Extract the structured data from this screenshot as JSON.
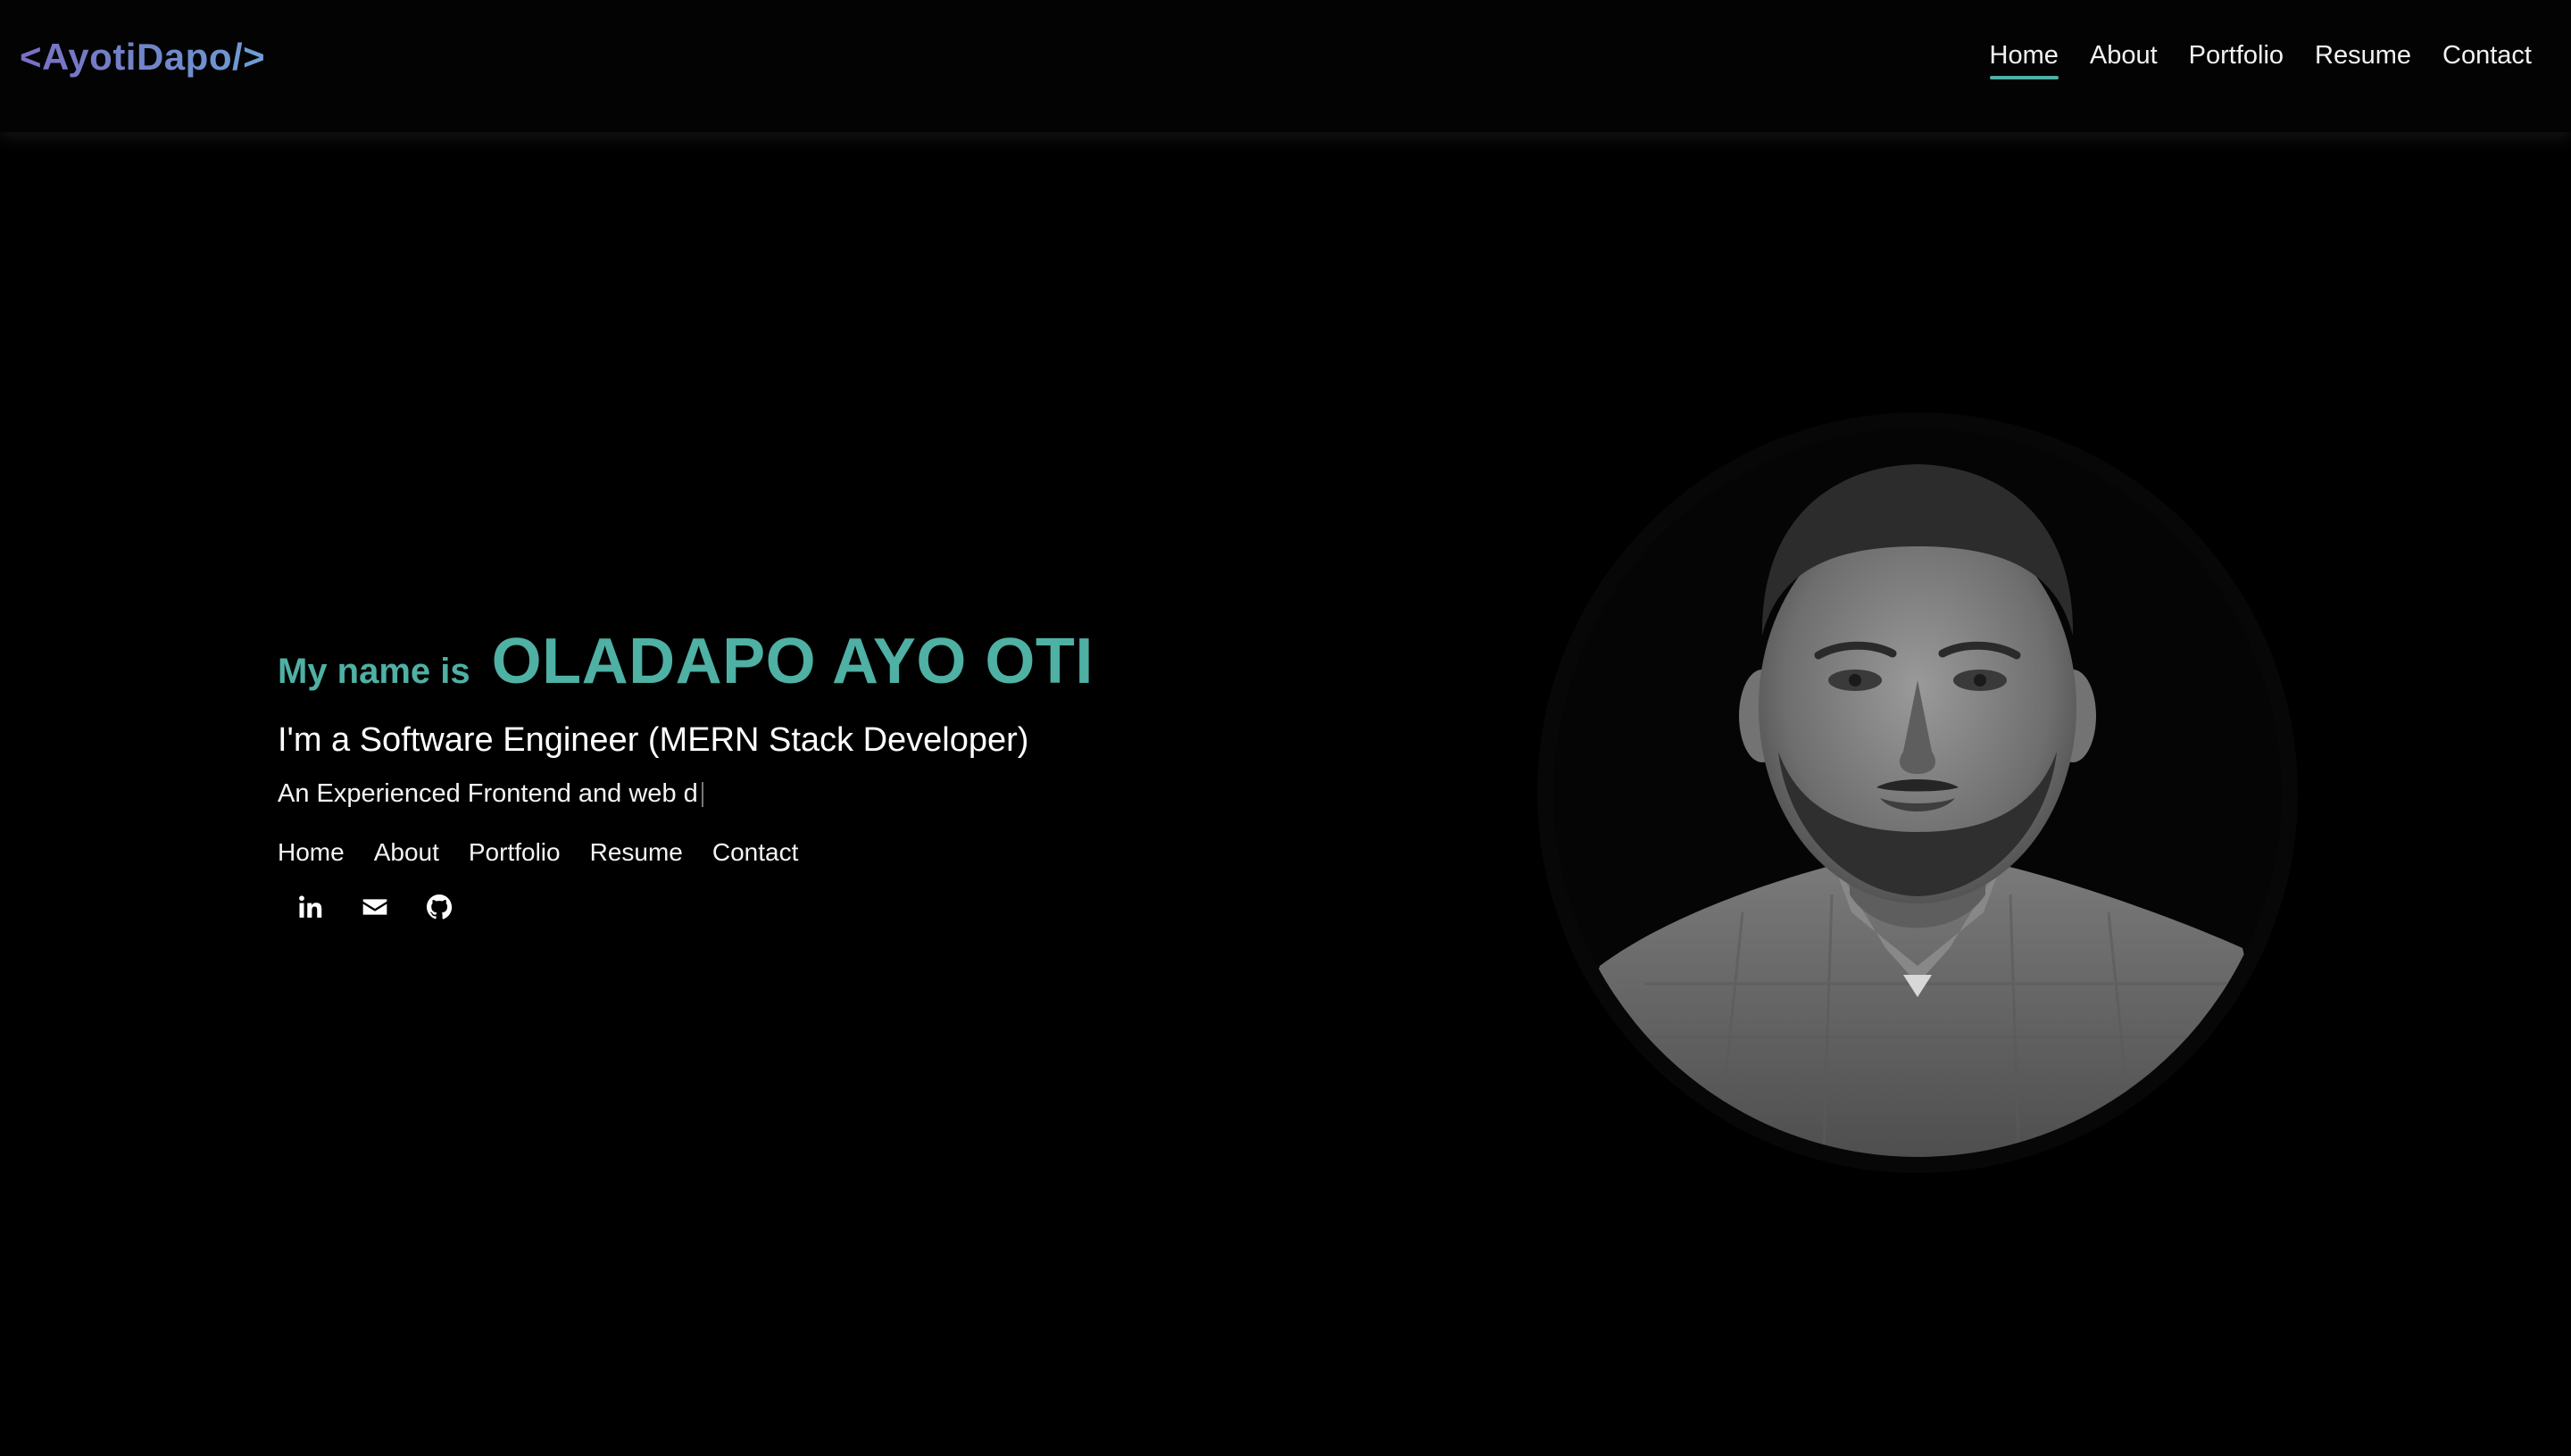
{
  "header": {
    "brand": "<AyotiDapo/>",
    "nav": [
      {
        "label": "Home",
        "active": true
      },
      {
        "label": "About",
        "active": false
      },
      {
        "label": "Portfolio",
        "active": false
      },
      {
        "label": "Resume",
        "active": false
      },
      {
        "label": "Contact",
        "active": false
      }
    ]
  },
  "hero": {
    "intro": "My name is",
    "name": "OLADAPO AYO OTI",
    "role": "I'm a Software Engineer (MERN Stack Developer)",
    "typed_text": "An Experienced Frontend and web d",
    "subnav": [
      "Home",
      "About",
      "Portfolio",
      "Resume",
      "Contact"
    ],
    "socials": [
      {
        "icon": "linkedin-icon"
      },
      {
        "icon": "envelope-icon"
      },
      {
        "icon": "github-icon"
      }
    ]
  },
  "colors": {
    "accent": "#4fb0a4",
    "brand_gradient_start": "#7b6fc4",
    "brand_gradient_end": "#6f9fd6",
    "background": "#000000"
  }
}
